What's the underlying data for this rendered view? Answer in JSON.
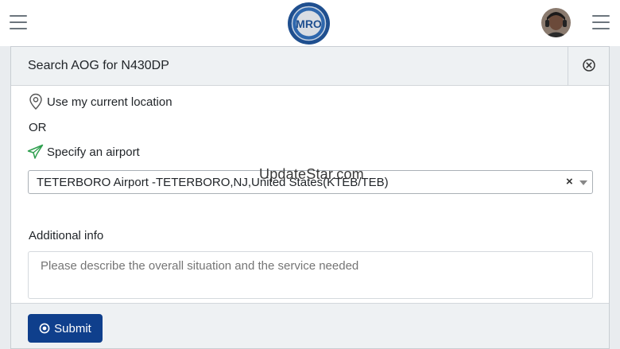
{
  "header": {
    "logo_text": "MRO",
    "menu_icon": "hamburger-icon",
    "profile_icon": "avatar"
  },
  "modal": {
    "title": "Search AOG for N430DP",
    "close_icon": "close-circle-icon",
    "location_option": {
      "icon": "map-pin-icon",
      "label": "Use my current location"
    },
    "or_text": "OR",
    "airport_option": {
      "icon": "plane-icon",
      "label": "Specify an airport",
      "selected_value": "TETERBORO Airport -TETERBORO,NJ,United States(KTEB/TEB)",
      "clear_label": "×"
    },
    "watermark": "UpdateStar.com",
    "additional_info": {
      "label": "Additional info",
      "placeholder": "Please describe the overall situation and the service needed"
    },
    "submit": {
      "label": "Submit",
      "icon": "dot-circle-icon"
    }
  },
  "colors": {
    "primary": "#0f3f8c",
    "header_bg": "#eef1f3",
    "pin_icon": "#555555",
    "plane_icon": "#2e9f4e"
  }
}
